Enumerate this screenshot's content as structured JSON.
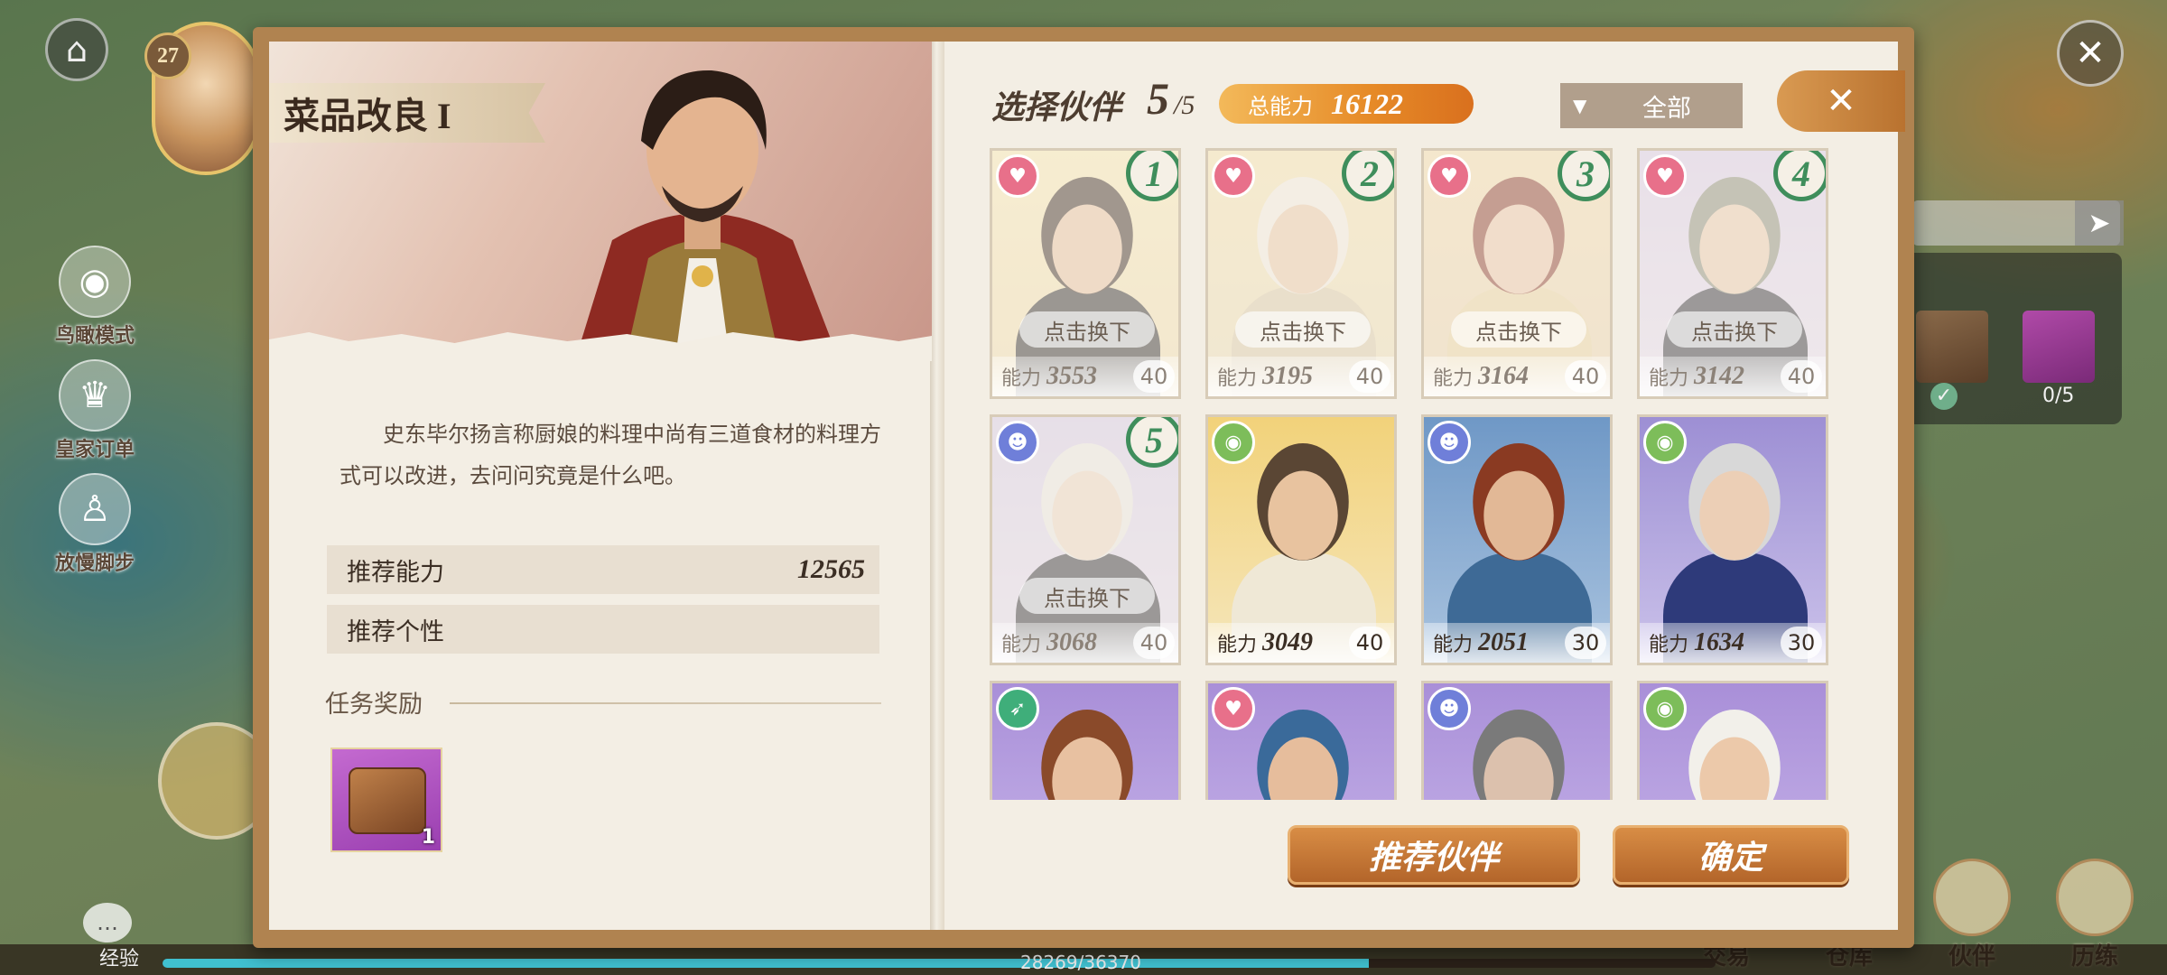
{
  "hud": {
    "level": "27",
    "side_buttons": [
      {
        "label": "鸟瞰模式",
        "icon": "eye-icon"
      },
      {
        "label": "皇家订单",
        "icon": "crown-icon"
      },
      {
        "label": "放慢脚步",
        "icon": "walk-icon"
      }
    ],
    "exp_label": "经验",
    "exp_text": "28269/36370",
    "exp_fraction": 0.777,
    "bottom_nav": [
      "交易",
      "仓库",
      "伙伴",
      "历练"
    ],
    "hud_item_count": "0/5"
  },
  "quest": {
    "title": "菜品改良 I",
    "description": "史东毕尔扬言称厨娘的料理中尚有三道食材的料理方式可以改进，去问问究竟是什么吧。",
    "recommended_power_label": "推荐能力",
    "recommended_power": "12565",
    "recommended_trait_label": "推荐个性",
    "reward_title": "任务奖励",
    "reward_qty": "1"
  },
  "partner_select": {
    "title": "选择伙伴",
    "selected_count": "5",
    "max_count": "/5",
    "total_power_label": "总能力",
    "total_power": "16122",
    "filter_value": "全部",
    "swap_label": "点击换下",
    "power_label": "能力",
    "cards": [
      {
        "order": "1",
        "trait": "heart",
        "power": "3553",
        "level": "40",
        "selected": true
      },
      {
        "order": "2",
        "trait": "heart",
        "power": "3195",
        "level": "40",
        "selected": true
      },
      {
        "order": "3",
        "trait": "heart",
        "power": "3164",
        "level": "40",
        "selected": true
      },
      {
        "order": "4",
        "trait": "heart",
        "power": "3142",
        "level": "40",
        "selected": true
      },
      {
        "order": "5",
        "trait": "ghost",
        "power": "3068",
        "level": "40",
        "selected": true
      },
      {
        "order": "",
        "trait": "eye",
        "power": "3049",
        "level": "40",
        "selected": false
      },
      {
        "order": "",
        "trait": "ghost",
        "power": "2051",
        "level": "30",
        "selected": false
      },
      {
        "order": "",
        "trait": "eye",
        "power": "1634",
        "level": "30",
        "selected": false
      },
      {
        "order": "",
        "trait": "run",
        "power": "",
        "level": "",
        "selected": false
      },
      {
        "order": "",
        "trait": "heart",
        "power": "",
        "level": "",
        "selected": false
      },
      {
        "order": "",
        "trait": "ghost",
        "power": "",
        "level": "",
        "selected": false
      },
      {
        "order": "",
        "trait": "eye",
        "power": "",
        "level": "",
        "selected": false
      }
    ],
    "recommend_button": "推荐伙伴",
    "confirm_button": "确定"
  },
  "colors": {
    "trait_heart": "#e8708a",
    "trait_eye": "#7dbd5a",
    "trait_ghost": "#6f7fd9",
    "trait_run": "#3fae7a",
    "order_ring": "#3f8e5c",
    "accent_orange": "#e68a27"
  }
}
